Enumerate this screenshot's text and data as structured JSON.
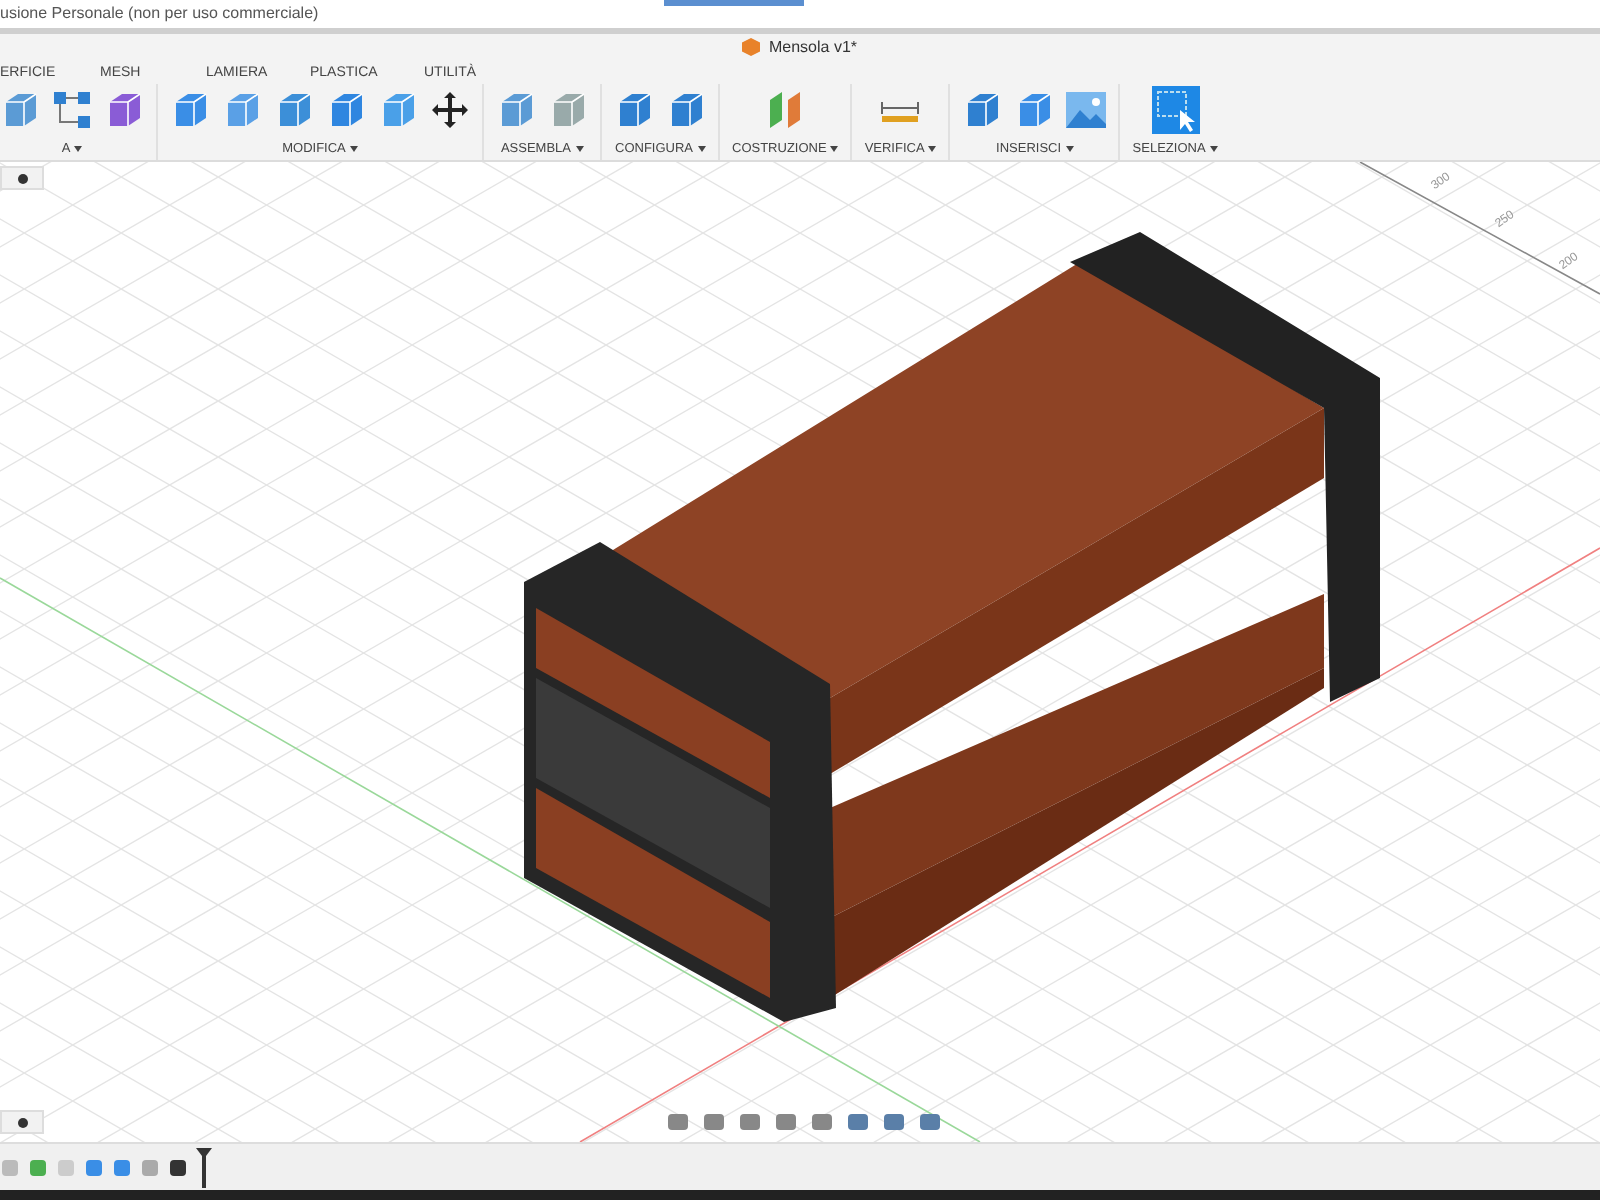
{
  "window": {
    "title": "usione Personale (non per uso commerciale)"
  },
  "document_tab": {
    "title": "Mensola v1*"
  },
  "toolbar": {
    "tabs": [
      {
        "label": "ERFICIE"
      },
      {
        "label": "MESH"
      },
      {
        "label": "LAMIERA"
      },
      {
        "label": "PLASTICA"
      },
      {
        "label": "UTILITÀ"
      }
    ],
    "groups": [
      {
        "label": "A"
      },
      {
        "label": "MODIFICA"
      },
      {
        "label": "ASSEMBLA"
      },
      {
        "label": "CONFIGURA"
      },
      {
        "label": "COSTRUZIONE"
      },
      {
        "label": "VERIFICA"
      },
      {
        "label": "INSERISCI"
      },
      {
        "label": "SELEZIONA"
      }
    ]
  },
  "viewport": {
    "ruler_labels": [
      "300",
      "250",
      "200"
    ]
  }
}
